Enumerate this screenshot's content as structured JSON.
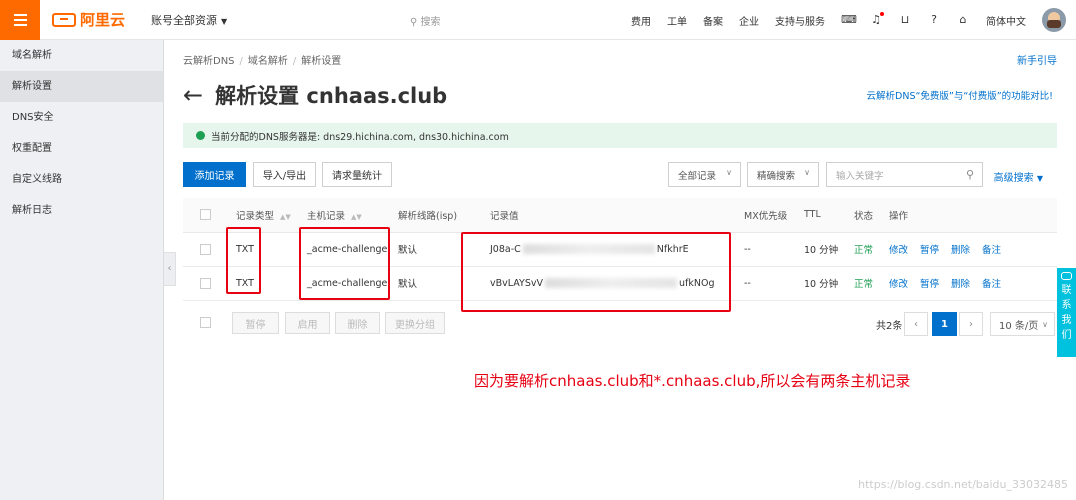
{
  "topbar": {
    "logo_text": "阿里云",
    "account_scope": "账号全部资源",
    "search_placeholder": "搜索",
    "nav": [
      "费用",
      "工单",
      "备案",
      "企业",
      "支持与服务"
    ],
    "language": "简体中文",
    "icons": [
      "terminal-icon",
      "bell-icon",
      "cart-icon",
      "help-icon",
      "home-icon"
    ],
    "accent_color": "#ff6a00"
  },
  "sidebar": {
    "items": [
      "域名解析",
      "解析设置",
      "DNS安全",
      "权重配置",
      "自定义线路",
      "解析日志"
    ],
    "active_index": 1
  },
  "breadcrumb": [
    "云解析DNS",
    "域名解析",
    "解析设置"
  ],
  "guide_link": "新手引导",
  "page_title": "解析设置 cnhaas.club",
  "compare_link": "云解析DNS“免费版”与“付费版”的功能对比!",
  "notice": "当前分配的DNS服务器是: dns29.hichina.com, dns30.hichina.com",
  "toolbar": {
    "add_record": "添加记录",
    "import_export": "导入/导出",
    "request_stats": "请求量统计",
    "filter_all": "全部记录",
    "search_mode": "精确搜索",
    "keyword_placeholder": "输入关键字",
    "advanced_search": "高级搜索"
  },
  "table": {
    "headers": [
      "记录类型",
      "主机记录",
      "解析线路(isp)",
      "记录值",
      "MX优先级",
      "TTL",
      "状态",
      "操作"
    ],
    "rows": [
      {
        "type": "TXT",
        "host": "_acme-challenge",
        "line": "默认",
        "value_start": "J08a-C",
        "value_end": "NfkhrE",
        "mx": "--",
        "ttl": "10 分钟",
        "status": "正常"
      },
      {
        "type": "TXT",
        "host": "_acme-challenge",
        "line": "默认",
        "value_start": "vBvLAYSvV",
        "value_end": "ufkNOg",
        "mx": "--",
        "ttl": "10 分钟",
        "status": "正常"
      }
    ],
    "actions": [
      "修改",
      "暂停",
      "删除",
      "备注"
    ]
  },
  "bulk": [
    "暂停",
    "启用",
    "删除",
    "更换分组"
  ],
  "pagination": {
    "total": "共2条",
    "current": "1",
    "page_size": "10 条/页"
  },
  "annotation": "因为要解析cnhaas.club和*.cnhaas.club,所以会有两条主机记录",
  "contact": [
    "联",
    "系",
    "我",
    "们"
  ],
  "watermark": "https://blog.csdn.net/baidu_33032485"
}
